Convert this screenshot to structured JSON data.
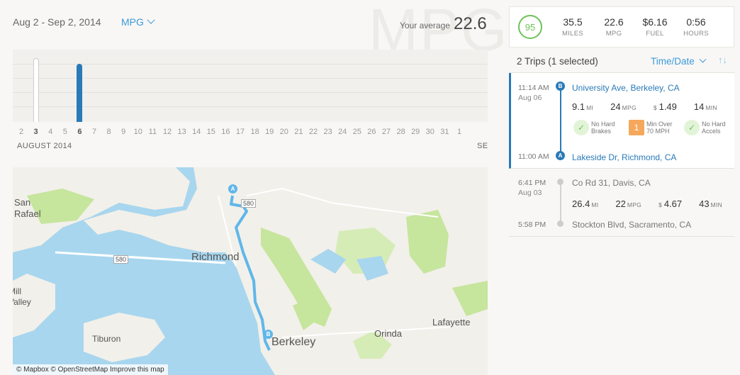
{
  "header": {
    "date_range": "Aug 2 - Sep 2, 2014",
    "metric": "MPG",
    "watermark": "MPG",
    "avg_label": "Your average",
    "avg_value": "22.6"
  },
  "chart": {
    "days": [
      "2",
      "3",
      "4",
      "5",
      "6",
      "7",
      "8",
      "9",
      "10",
      "11",
      "12",
      "13",
      "14",
      "15",
      "16",
      "17",
      "18",
      "19",
      "20",
      "21",
      "22",
      "23",
      "24",
      "25",
      "26",
      "27",
      "28",
      "29",
      "30",
      "31",
      "1"
    ],
    "bold_days": [
      "3",
      "6"
    ],
    "month_label": "AUGUST 2014",
    "next_month_label": "SE",
    "bars": [
      {
        "day": "3",
        "mpg": 26.4,
        "selected": false
      },
      {
        "day": "6",
        "mpg": 24,
        "selected": true
      }
    ]
  },
  "map": {
    "attribution": "© Mapbox © OpenStreetMap Improve this map",
    "labels": [
      "San Rafael",
      "Richmond",
      "Berkeley",
      "Orinda",
      "Lafayette",
      "Tiburon",
      "Mill Valley",
      "580",
      "580"
    ],
    "pin_a": "A",
    "pin_b": "B"
  },
  "summary": {
    "score": "95",
    "stats": [
      {
        "value": "35.5",
        "label": "MILES"
      },
      {
        "value": "22.6",
        "label": "MPG"
      },
      {
        "value": "$6.16",
        "label": "FUEL"
      },
      {
        "value": "0:56",
        "label": "HOURS"
      }
    ]
  },
  "trips_header": {
    "count": "2 Trips (1 selected)",
    "sort": "Time/Date",
    "sort_icon": "sort-direction-icon"
  },
  "trips": [
    {
      "end_time": "11:14 AM",
      "date": "Aug 06",
      "end_addr": "University Ave, Berkeley, CA",
      "start_time": "11:00 AM",
      "start_addr": "Lakeside Dr, Richmond, CA",
      "miles": "9.1",
      "mi_unit": "MI",
      "mpg": "24",
      "mpg_unit": "MPG",
      "currency": "$",
      "fuel": "1.49",
      "min": "14",
      "min_unit": "MIN",
      "pin_end": "B",
      "pin_start": "A",
      "badges": [
        {
          "icon": "check-icon",
          "mark": "✓",
          "line1": "No Hard",
          "line2": "Brakes"
        },
        {
          "icon": "warning-icon",
          "mark": "1",
          "line1": "Min Over",
          "line2": "70 MPH"
        },
        {
          "icon": "check-icon",
          "mark": "✓",
          "line1": "No Hard",
          "line2": "Accels"
        }
      ]
    },
    {
      "end_time": "6:41 PM",
      "date": "Aug 03",
      "end_addr": "Co Rd 31, Davis, CA",
      "start_time": "5:58 PM",
      "start_addr": "Stockton Blvd, Sacramento, CA",
      "miles": "26.4",
      "mi_unit": "MI",
      "mpg": "22",
      "mpg_unit": "MPG",
      "currency": "$",
      "fuel": "4.67",
      "min": "43",
      "min_unit": "MIN"
    }
  ]
}
